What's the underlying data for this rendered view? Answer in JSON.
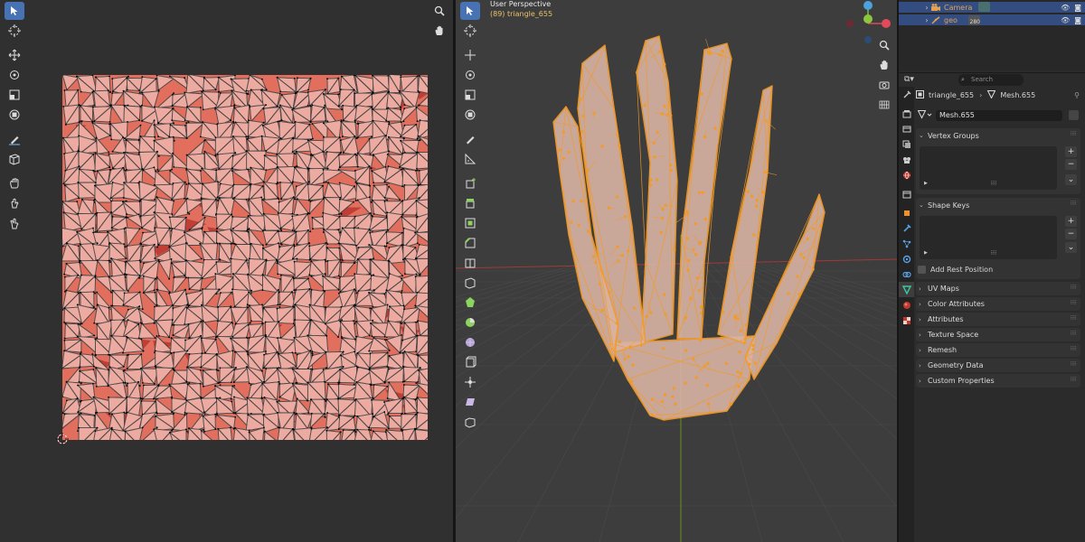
{
  "viewport": {
    "title": "User Perspective",
    "subtitle": "(89) triangle_655"
  },
  "outliner": {
    "rows": [
      {
        "label": "Camera",
        "icon": "camera-icon"
      },
      {
        "label": "geo",
        "icon": "armature-icon",
        "badge": "280"
      }
    ]
  },
  "properties": {
    "search_placeholder": "Search",
    "object_name": "triangle_655",
    "mesh_name": "Mesh.655",
    "mesh_field": "Mesh.655",
    "panels": {
      "vertex_groups": "Vertex Groups",
      "shape_keys": "Shape Keys",
      "add_rest_position": "Add Rest Position",
      "uv_maps": "UV Maps",
      "color_attributes": "Color Attributes",
      "attributes": "Attributes",
      "texture_space": "Texture Space",
      "remesh": "Remesh",
      "geometry_data": "Geometry Data",
      "custom_properties": "Custom Properties"
    }
  },
  "colors": {
    "accent": "#4772b3",
    "selection_orange": "#f59a23",
    "uv_background": "#e26f5e",
    "face_fill": "#ecaaa0",
    "grid_red": "#a13a3a",
    "grid_green": "#6b8e23"
  }
}
